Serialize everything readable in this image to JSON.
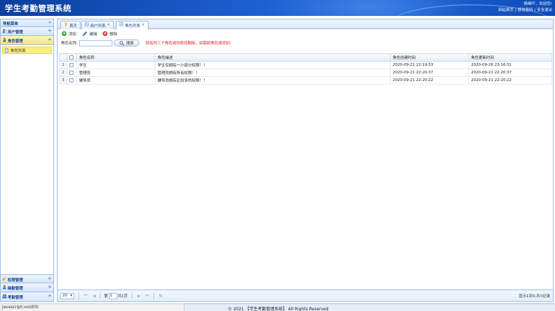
{
  "header": {
    "title": "学生考勤管理系统",
    "welcome": "杨晰吖，欢迎您!",
    "links": [
      "网站首页",
      "修改密码",
      "安全退出"
    ]
  },
  "nav": {
    "title": "导航菜单",
    "panels": [
      {
        "label": "用户管理",
        "icon": "users-icon"
      },
      {
        "label": "角色管理",
        "icon": "role-icon",
        "active": true,
        "items": [
          "角色列表"
        ]
      }
    ],
    "bottom_panels": [
      {
        "label": "权限管理",
        "icon": "key-icon"
      },
      {
        "label": "缺勤管理",
        "icon": "user-icon"
      },
      {
        "label": "考勤管理",
        "icon": "group-icon"
      }
    ]
  },
  "tabs": [
    {
      "label": "首页",
      "closable": false
    },
    {
      "label": "用户列表",
      "closable": true
    },
    {
      "label": "角色列表",
      "closable": true,
      "active": true
    }
  ],
  "toolbar": {
    "add": "添加",
    "edit": "编辑",
    "delete": "删除"
  },
  "search": {
    "label": "角色名称:",
    "value": "",
    "button": "搜索",
    "hint": "原有的三个角色请勿修改删除，如需新角色请添加!"
  },
  "grid": {
    "columns": [
      "角色名称",
      "角色描述",
      "角色创建时间",
      "角色更新时间"
    ],
    "rows": [
      {
        "num": "1",
        "name": "学生",
        "desc": "学生仅拥有一小部分权限！！",
        "created": "2020-09-21 22:19:53",
        "updated": "2020-09-26 23:16:31"
      },
      {
        "num": "2",
        "name": "管理员",
        "desc": "管理员拥有所有权限！！",
        "created": "2020-09-21 22:20:37",
        "updated": "2020-09-21 22:20:37"
      },
      {
        "num": "3",
        "name": "辅导员",
        "desc": "辅导员拥有比较多的权限！！",
        "created": "2020-09-21 22:20:22",
        "updated": "2020-09-21 22:20:22"
      }
    ]
  },
  "pager": {
    "page_size": "20",
    "page_prefix": "第",
    "page": "1",
    "page_suffix": "共1页",
    "info": "显示1到3,共3记录"
  },
  "statusbar": "javascript:void(0)",
  "footer": "© 2021 【学生考勤管理系统】 All Rights Reserved"
}
